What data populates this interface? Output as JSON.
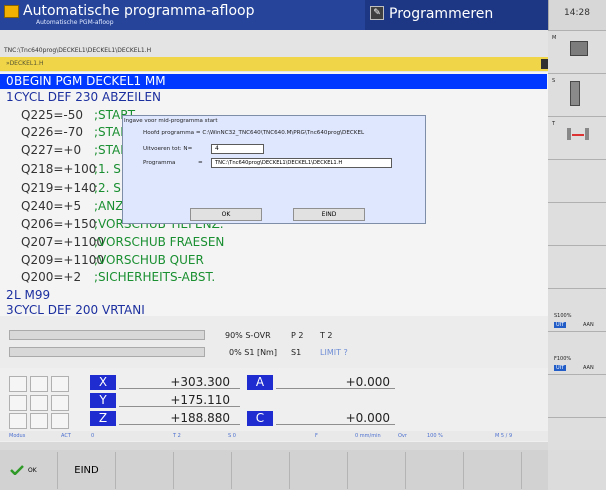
{
  "header": {
    "mode_title": "Automatische programma-afloop",
    "mode_subtitle": "Automatische PGM-afloop",
    "programming_label": "Programmeren",
    "clock": "14:28"
  },
  "path_bar": {
    "path": "TNC:\\Tnc640prog\\DECKEL1\\DECKEL1\\DECKEL1.H",
    "file_tab": "»DECKEL1.H"
  },
  "program": {
    "lines": [
      {
        "num": "0",
        "text": "BEGIN PGM DECKEL1 MM",
        "highlighted": true
      },
      {
        "num": "1",
        "text": "CYCL DEF 230 ABZEILEN"
      },
      {
        "num": "",
        "param": "Q225=-50",
        "comment": ";START"
      },
      {
        "num": "",
        "param": "Q226=-70",
        "comment": ";START"
      },
      {
        "num": "",
        "param": "Q227=+0",
        "comment": ";START"
      },
      {
        "num": "",
        "param": "Q218=+100",
        "comment": ";1. SEI"
      },
      {
        "num": "",
        "param": "Q219=+140",
        "comment": ";2. SEI"
      },
      {
        "num": "",
        "param": "Q240=+5",
        "comment": ";ANZAH"
      },
      {
        "num": "",
        "param": "Q206=+150",
        "comment": ";VORSCHUB TIEFENZ."
      },
      {
        "num": "",
        "param": "Q207=+1100",
        "comment": ";VORSCHUB FRAESEN"
      },
      {
        "num": "",
        "param": "Q209=+1100",
        "comment": ";VORSCHUB QUER"
      },
      {
        "num": "",
        "param": "Q200=+2",
        "comment": ";SICHERHEITS-ABST."
      },
      {
        "num": "2",
        "text": "L M99"
      },
      {
        "num": "3",
        "text": "CYCL DEF 200 VRTANI"
      }
    ]
  },
  "dialog": {
    "title": "Ingave voor mid-programma start",
    "main_program_label": "Hoofd programma = C:\\WinNC32_TNC640\\TNC640.M\\PRG\\Tnc640prog\\DECKEL",
    "execute_label": "Uitvoeren tot: N=",
    "execute_value": "4",
    "program_label": "Programma",
    "program_eq": "=",
    "program_value": "TNC:\\Tnc640prog\\DECKEL1\\DECKEL1\\DECKEL1.H",
    "ok_label": "OK",
    "end_label": "EIND"
  },
  "status": {
    "s_ovr": "90% S-OVR",
    "p2": "P 2",
    "t2": "T 2",
    "s1": "0% S1 [Nm]",
    "s1_label": "S1",
    "limit": "LIMIT ?"
  },
  "positions": {
    "axes": [
      {
        "axis": "X",
        "value": "+303.300"
      },
      {
        "axis": "Y",
        "value": "+175.110"
      },
      {
        "axis": "Z",
        "value": "+188.880"
      }
    ],
    "extra_axes": [
      {
        "axis": "A",
        "value": "+0.000"
      },
      {
        "axis": "C",
        "value": "+0.000"
      }
    ],
    "info": {
      "modus": "Modus",
      "act": "ACT",
      "zero": "0",
      "tool": "T 2",
      "sp": "S  0",
      "f": "F",
      "f_val": "0 mm/min",
      "ovr": "Ovr",
      "ovr_val": "100 %",
      "m": "M 5 / 9"
    }
  },
  "softkeys": {
    "ok": "OK",
    "end": "EIND"
  },
  "right_panel": {
    "m": "M",
    "s": "S",
    "t": "T",
    "s100": "S100%",
    "f100": "F100%",
    "uit": "UIT",
    "aan": "AAN"
  }
}
